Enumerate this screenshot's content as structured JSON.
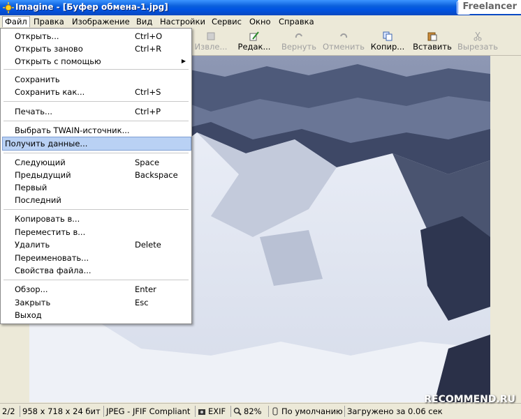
{
  "window": {
    "title": "Imagine - [Буфер обмена-1.jpg]",
    "freelancer_badge": "Freelancer"
  },
  "menubar": {
    "items": [
      "Файл",
      "Правка",
      "Изображение",
      "Вид",
      "Настройки",
      "Сервис",
      "Окно",
      "Справка"
    ]
  },
  "toolbar": {
    "buttons": [
      {
        "label": "Извле...",
        "enabled": false,
        "icon": "extract-icon"
      },
      {
        "label": "Редак...",
        "enabled": true,
        "icon": "edit-icon"
      },
      {
        "label": "Вернуть",
        "enabled": false,
        "icon": "redo-icon"
      },
      {
        "label": "Отменить",
        "enabled": false,
        "icon": "undo-icon"
      },
      {
        "label": "Копир...",
        "enabled": true,
        "icon": "copy-icon"
      },
      {
        "label": "Вставить",
        "enabled": true,
        "icon": "paste-icon"
      },
      {
        "label": "Вырезать",
        "enabled": false,
        "icon": "cut-icon"
      }
    ]
  },
  "file_menu": {
    "items": [
      {
        "label": "Открыть...",
        "shortcut": "Ctrl+O"
      },
      {
        "label": "Открыть заново",
        "shortcut": "Ctrl+R"
      },
      {
        "label": "Открыть с помощью",
        "shortcut": "",
        "submenu": true
      },
      {
        "label": "Сохранить",
        "shortcut": ""
      },
      {
        "label": "Сохранить как...",
        "shortcut": "Ctrl+S"
      },
      {
        "label": "Печать...",
        "shortcut": "Ctrl+P"
      },
      {
        "label": "Выбрать TWAIN-источник...",
        "shortcut": ""
      },
      {
        "label": "Получить данные...",
        "shortcut": "",
        "highlighted": true
      },
      {
        "label": "Следующий",
        "shortcut": "Space"
      },
      {
        "label": "Предыдущий",
        "shortcut": "Backspace"
      },
      {
        "label": "Первый",
        "shortcut": ""
      },
      {
        "label": "Последний",
        "shortcut": ""
      },
      {
        "label": "Копировать в...",
        "shortcut": ""
      },
      {
        "label": "Переместить в...",
        "shortcut": ""
      },
      {
        "label": "Удалить",
        "shortcut": "Delete"
      },
      {
        "label": "Переименовать...",
        "shortcut": ""
      },
      {
        "label": "Свойства файла...",
        "shortcut": ""
      },
      {
        "label": "Обзор...",
        "shortcut": "Enter"
      },
      {
        "label": "Закрыть",
        "shortcut": "Esc"
      },
      {
        "label": "Выход",
        "shortcut": ""
      }
    ]
  },
  "statusbar": {
    "index": "2/2",
    "dimensions": "958 x 718 x 24 бит",
    "format": "JPEG - JFIF Compliant",
    "exif": "EXIF",
    "zoom": "82%",
    "profile": "По умолчанию",
    "load_time": "Загружено за 0.06 сек"
  },
  "watermark": "RECOMMEND.RU",
  "colors": {
    "titlebar": "#0054e3",
    "highlight": "#b9d1f4",
    "window_bg": "#ece9d8"
  }
}
